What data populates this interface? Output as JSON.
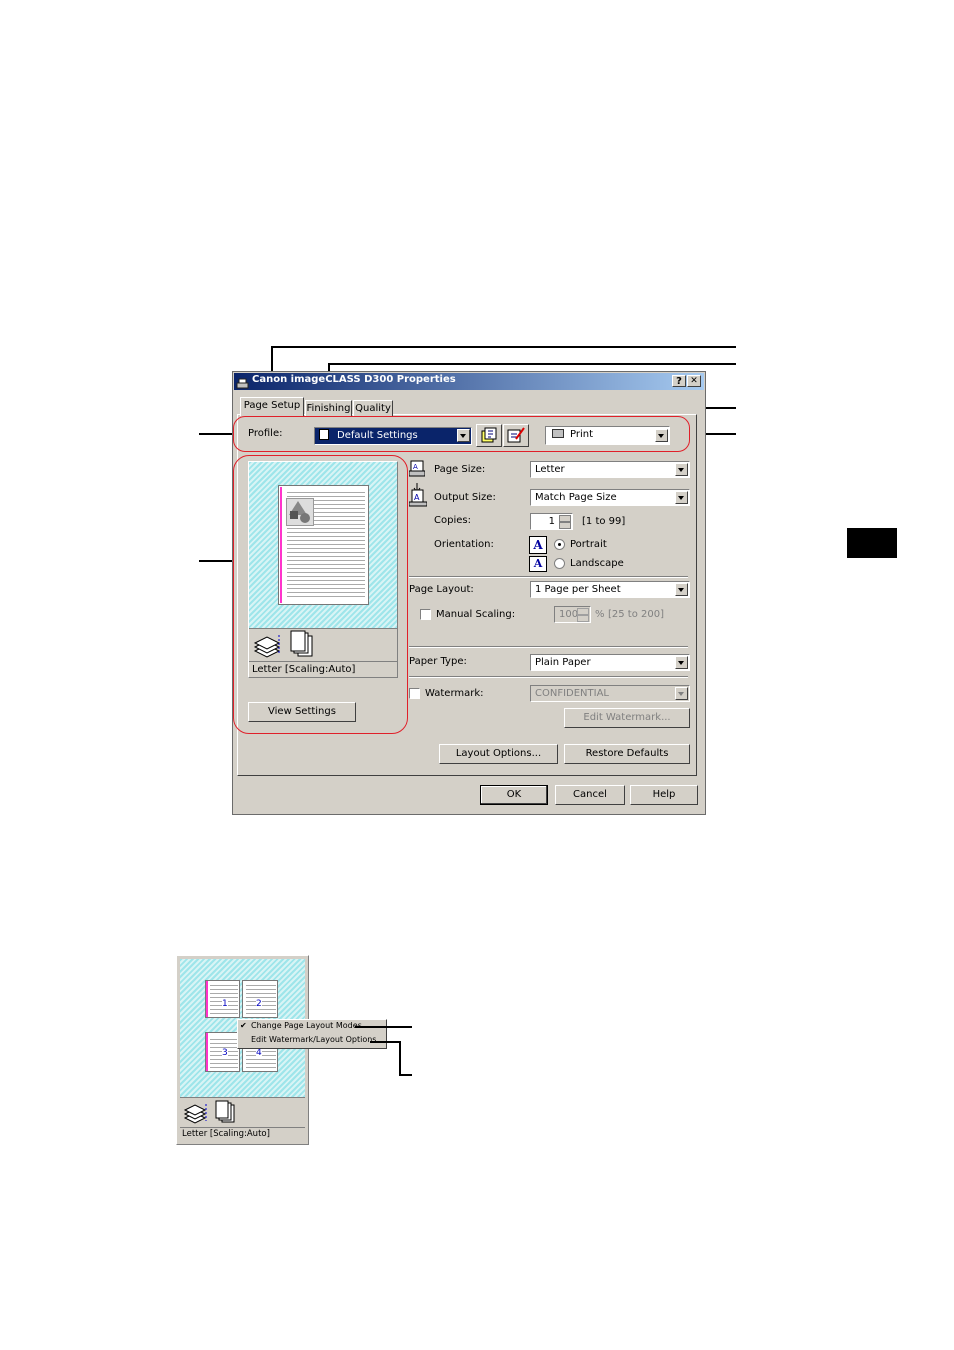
{
  "dialog": {
    "title": "Canon imageCLASS D300 Properties",
    "help_btn": "?",
    "close_btn": "✕"
  },
  "tabs": [
    "Page Setup",
    "Finishing",
    "Quality"
  ],
  "profile": {
    "label": "Profile:",
    "value": "Default Settings",
    "output_method": "Print"
  },
  "preview": {
    "caption": "Letter [Scaling:Auto]",
    "view_settings": "View Settings"
  },
  "page_size": {
    "label": "Page Size:",
    "value": "Letter"
  },
  "output_size": {
    "label": "Output Size:",
    "value": "Match Page Size"
  },
  "copies": {
    "label": "Copies:",
    "value": "1",
    "range": "[1 to 99]"
  },
  "orientation": {
    "label": "Orientation:",
    "portrait": "Portrait",
    "landscape": "Landscape",
    "selected": "Portrait"
  },
  "page_layout": {
    "label": "Page Layout:",
    "value": "1 Page per Sheet"
  },
  "manual_scaling": {
    "label": "Manual Scaling:",
    "value": "100",
    "percent": "%",
    "range": "[25 to 200]"
  },
  "paper_type": {
    "label": "Paper Type:",
    "value": "Plain Paper"
  },
  "watermark": {
    "label": "Watermark:",
    "value": "CONFIDENTIAL",
    "edit": "Edit Watermark..."
  },
  "buttons": {
    "layout_options": "Layout Options...",
    "restore_defaults": "Restore Defaults",
    "ok": "OK",
    "cancel": "Cancel",
    "help": "Help"
  },
  "small_preview": {
    "page_numbers": [
      "1",
      "2",
      "3",
      "4"
    ],
    "menu": [
      "Change Page Layout Modes",
      "Edit Watermark/Layout Options"
    ],
    "menu_checked": "✔",
    "caption": "Letter [Scaling:Auto]"
  },
  "colors": {
    "titlebar": "#0a246a",
    "dialog": "#d4d0c8",
    "callout_outline": "#e0202a",
    "preview_bg": "#9ee5ea",
    "margin_line": "#ff33cc"
  }
}
